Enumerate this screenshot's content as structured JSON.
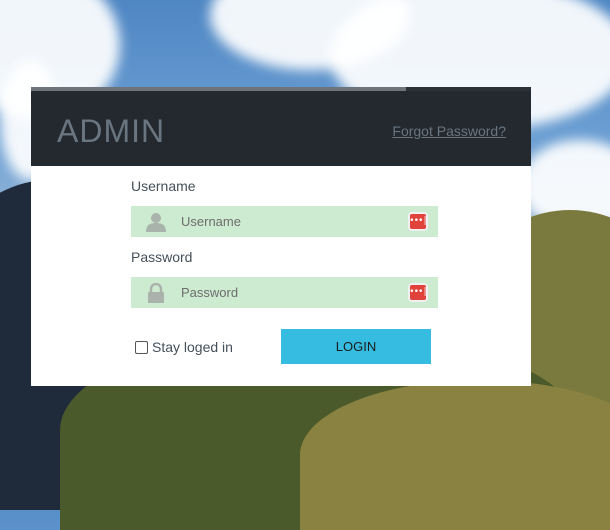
{
  "header": {
    "brand": "ADMIN",
    "forgot_link": "Forgot Password?",
    "progress": 0.75
  },
  "form": {
    "username": {
      "label": "Username",
      "placeholder": "Username",
      "value": ""
    },
    "password": {
      "label": "Password",
      "placeholder": "Password",
      "value": ""
    },
    "stay_logged_in": {
      "label": "Stay loged in",
      "checked": false
    },
    "login_button": "LOGIN"
  },
  "icons": {
    "username_field": "user-icon",
    "password_field": "lock-icon",
    "password_manager": "password-manager-icon"
  },
  "colors": {
    "header_bg": "#23292f",
    "field_bg": "#cdebd0",
    "button_bg": "#35bce0",
    "badge_bg": "#e0433b"
  }
}
